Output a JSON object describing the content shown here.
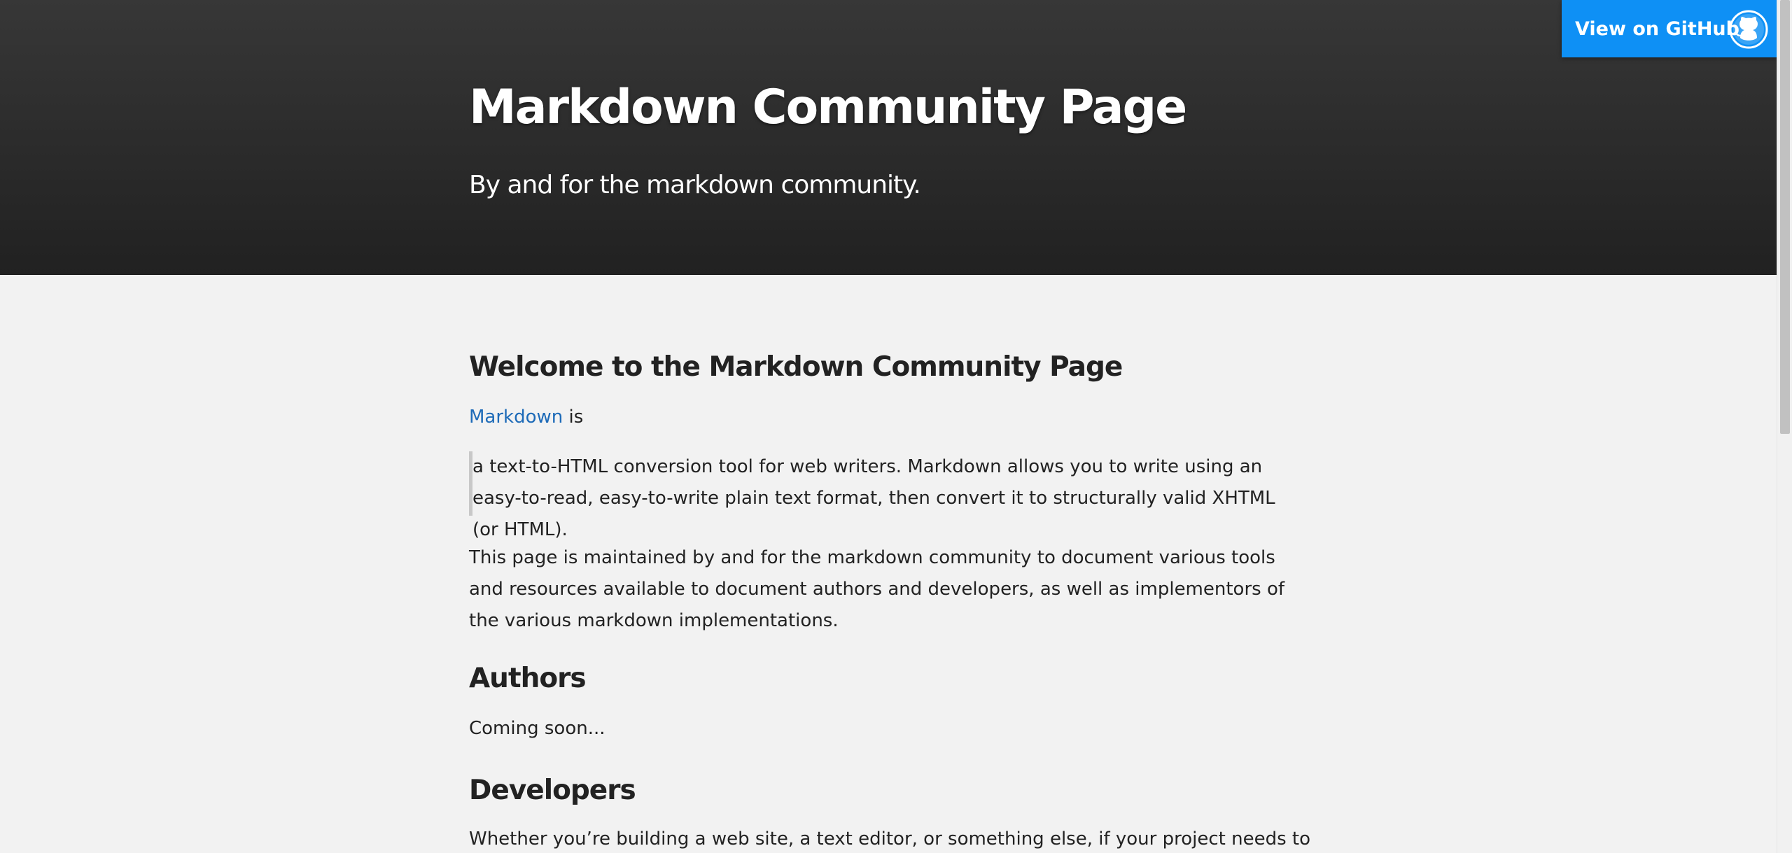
{
  "header": {
    "title": "Markdown Community Page",
    "tagline": "By and for the markdown community.",
    "github_button": {
      "label": "View on GitHub",
      "icon": "github-octocat-icon",
      "color": "#0e90f5"
    }
  },
  "content": {
    "welcome_heading": "Welcome to the Markdown Community Page",
    "intro": {
      "link_text": "Markdown",
      "after_link": " is"
    },
    "blockquote": "a text-to-HTML conversion tool for web writers. Markdown allows you to write using an easy-to-read, easy-to-write plain text format, then convert it to structurally valid XHTML (or HTML).",
    "maintained_paragraph": "This page is maintained by and for the markdown community to document various tools and resources available to document authors and developers, as well as implementors of the various markdown implementations.",
    "authors_heading": "Authors",
    "authors_text": "Coming soon...",
    "developers_heading": "Developers",
    "developers_text": "Whether you’re building a web site, a text editor, or something else, if your project needs to"
  },
  "colors": {
    "header_gradient_top": "#373737",
    "header_gradient_bottom": "#212121",
    "link": "#1e6bb8",
    "body_background": "#f2f2f2"
  }
}
